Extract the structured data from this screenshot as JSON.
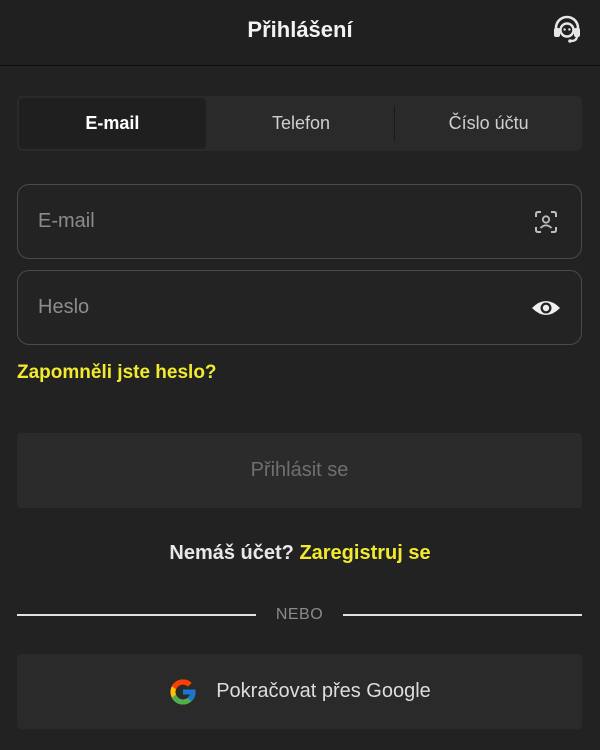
{
  "header": {
    "title": "Přihlášení",
    "support_icon": "headset-support-icon"
  },
  "tabs": [
    {
      "label": "E-mail",
      "active": true
    },
    {
      "label": "Telefon",
      "active": false
    },
    {
      "label": "Číslo účtu",
      "active": false
    }
  ],
  "form": {
    "email_placeholder": "E-mail",
    "email_value": "",
    "email_icon": "face-scan-icon",
    "password_placeholder": "Heslo",
    "password_value": "",
    "password_icon": "eye-icon",
    "forgot_label": "Zapomněli jste heslo?",
    "submit_label": "Přihlásit se"
  },
  "register": {
    "prompt": "Nemáš účet?",
    "link_label": "Zaregistruj se"
  },
  "divider_label": "NEBO",
  "google": {
    "label": "Pokračovat přes Google",
    "icon": "google-icon"
  },
  "colors": {
    "background": "#222222",
    "accent": "#f1ea2f",
    "disabled_text": "#6f6f6f"
  }
}
